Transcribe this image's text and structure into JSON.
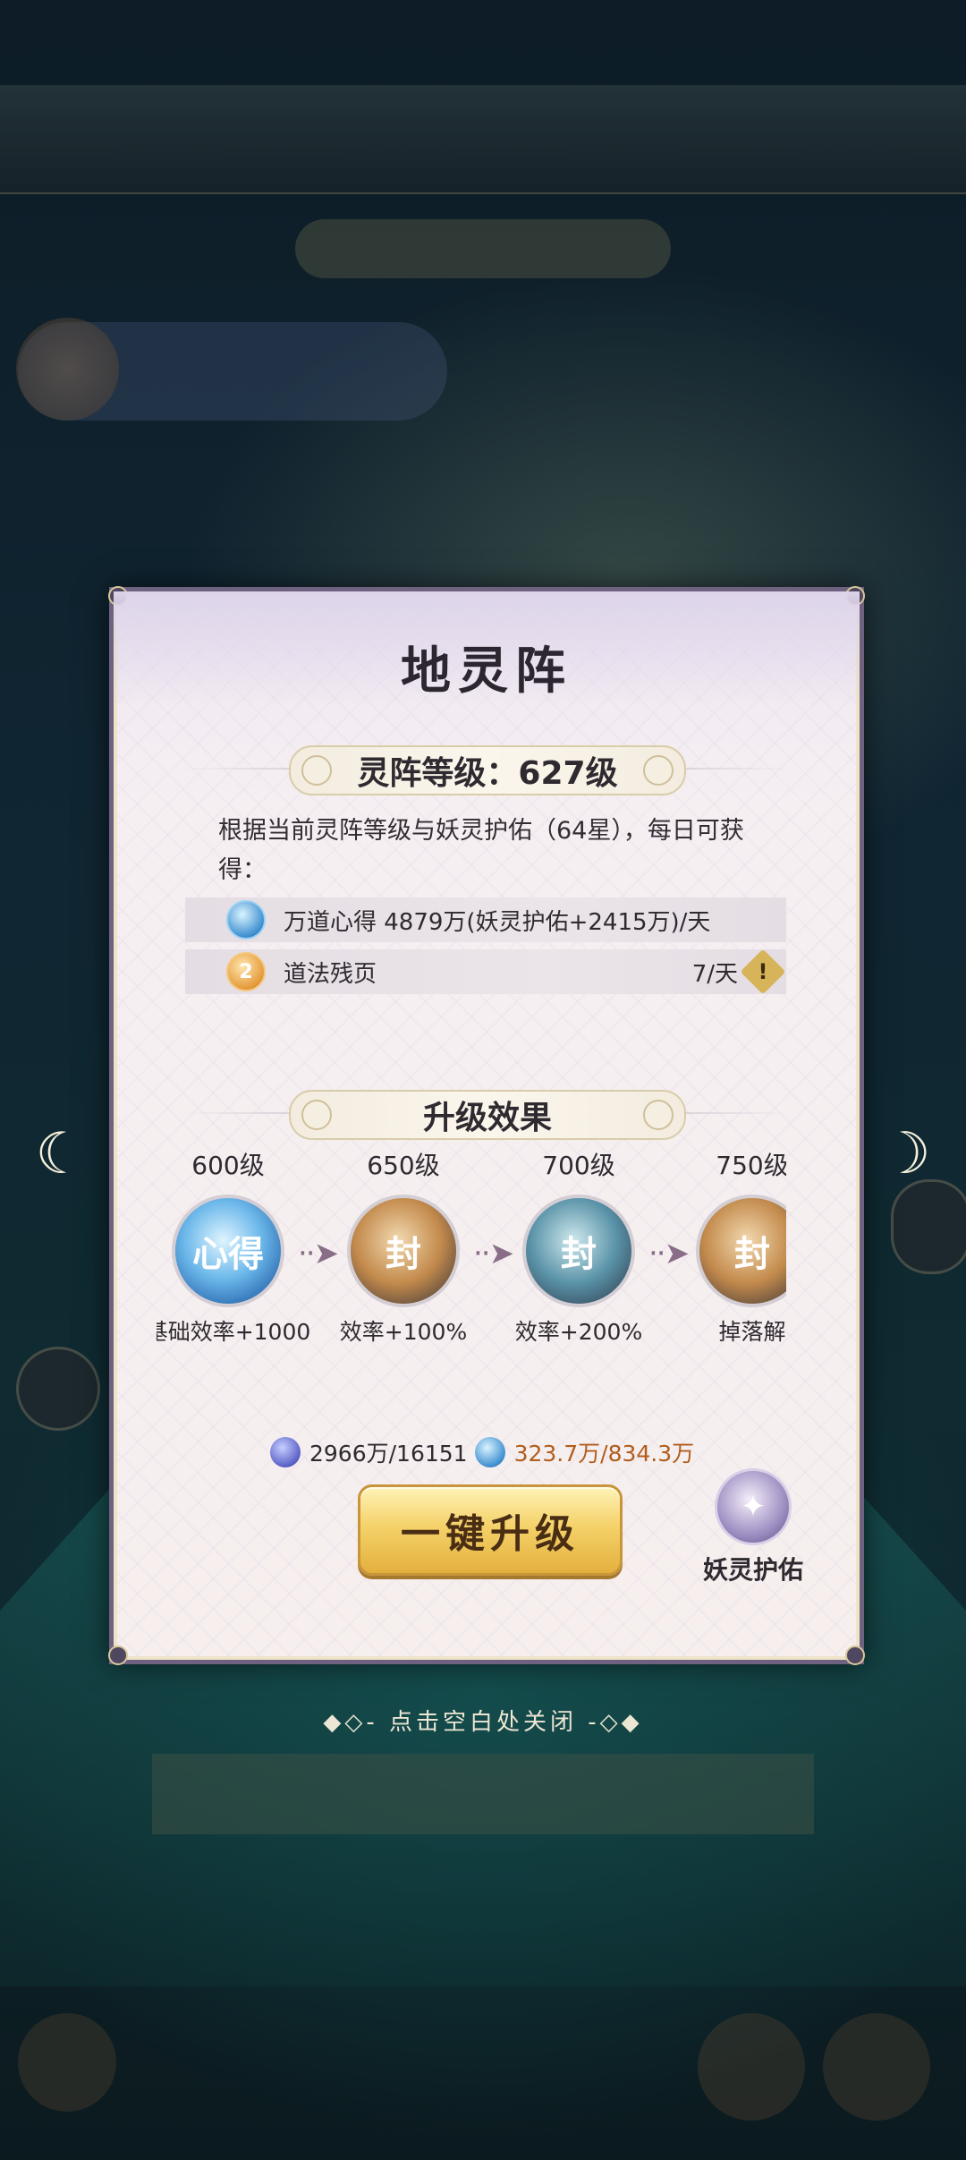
{
  "popup": {
    "title": "地灵阵",
    "level_banner": "灵阵等级：627级",
    "description": "根据当前灵阵等级与妖灵护佑（64星），每日可获得：",
    "rewards": [
      {
        "icon": "xinde-icon",
        "text": "万道心得 4879万(妖灵护佑+2415万)/天",
        "rate": ""
      },
      {
        "icon": "canye-icon",
        "text": "道法残页",
        "rate": "7/天"
      }
    ],
    "upgrade_banner": "升级效果",
    "milestones": [
      {
        "level": "600级",
        "effect": "基础效率+1000",
        "style": "blue"
      },
      {
        "level": "650级",
        "effect": "效率+100%",
        "style": "gold"
      },
      {
        "level": "700级",
        "effect": "效率+200%",
        "style": "teal"
      },
      {
        "level": "750级",
        "effect": "掉落解",
        "style": "gold"
      }
    ],
    "cost": {
      "item1": "2966万/16151",
      "item2": "323.7万/834.3万"
    },
    "upgrade_button": "一键升级",
    "blessing_label": "妖灵护佑"
  },
  "close_hint": "◆◇- 点击空白处关闭 -◇◆",
  "colors": {
    "panel_border": "#6f6280",
    "cost_warning": "#b15d1c",
    "button_gold": "#f5d26a"
  }
}
